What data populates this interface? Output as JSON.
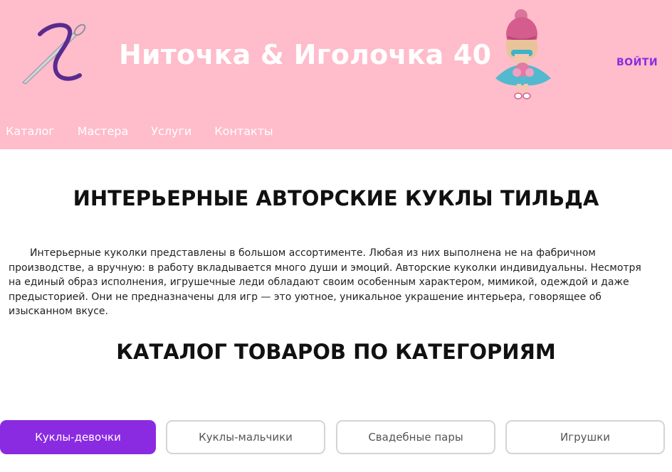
{
  "header": {
    "site_title": "Ниточка & Иголочка 40",
    "login_label": "ВОЙТИ",
    "logo_icon": "needle-thread-icon",
    "illustration": "tilda-doll-image"
  },
  "nav": {
    "items": [
      {
        "label": "Каталог"
      },
      {
        "label": "Мастера"
      },
      {
        "label": "Услуги"
      },
      {
        "label": "Контакты"
      }
    ]
  },
  "main": {
    "heading": "ИНТЕРЬЕРНЫЕ АВТОРСКИЕ КУКЛЫ ТИЛЬДА",
    "intro": "Интерьерные куколки представлены в большом ассортименте. Любая из них выполнена не на фабричном производстве, а вручную: в работу вкладывается много души и эмоций. Авторские куколки индивидуальны. Несмотря на единый образ исполнения, игрушечные леди обладают своим особенным характером, мимикой, одеждой и даже предысторией. Они не предназначены для игр — это уютное, уникальное украшение интерьера, говорящее об изысканном вкусе.",
    "catalog_heading": "КАТАЛОГ ТОВАРОВ ПО КАТЕГОРИЯМ"
  },
  "categories": [
    {
      "label": "Куклы-девочки",
      "active": true
    },
    {
      "label": "Куклы-мальчики",
      "active": false
    },
    {
      "label": "Свадебные пары",
      "active": false
    },
    {
      "label": "Игрушки",
      "active": false
    }
  ],
  "colors": {
    "header_bg": "#ffbccb",
    "accent": "#8a2be2",
    "button_border": "#d4d4d4"
  }
}
